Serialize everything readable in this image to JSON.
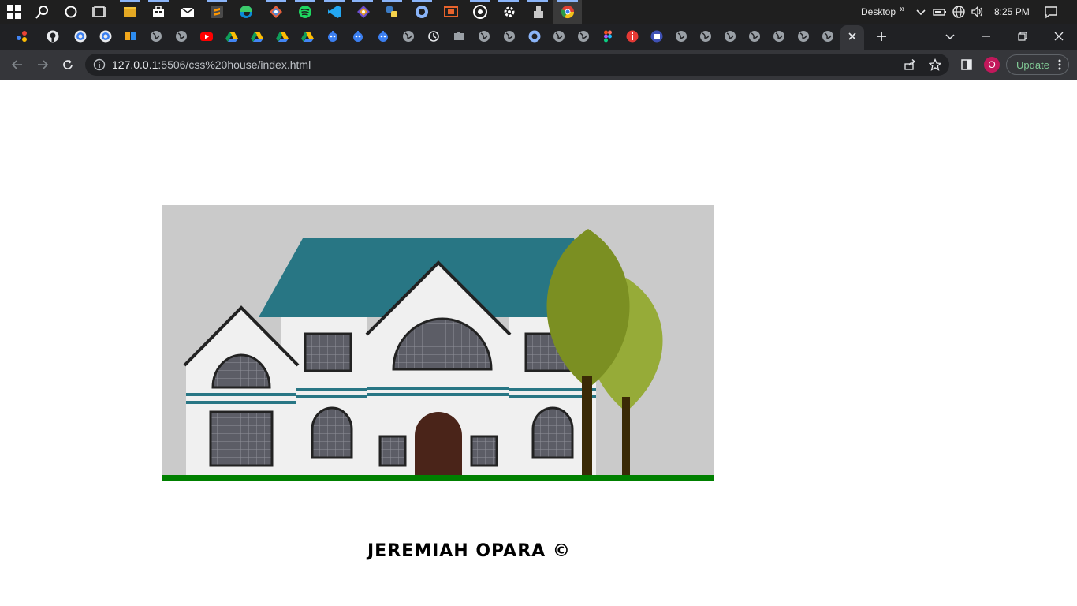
{
  "taskbar": {
    "apps": [
      "start-icon",
      "search-icon",
      "cortana-icon",
      "task-view-icon",
      "file-explorer-icon",
      "store-icon",
      "mail-icon",
      "sublime-icon",
      "edge-icon",
      "git-icon",
      "spotify-icon",
      "vscode-icon",
      "git-icon",
      "python-icon",
      "app-icon",
      "app-icon",
      "obs-icon",
      "settings-icon",
      "app-icon",
      "chrome-icon"
    ],
    "desktop_label": "Desktop",
    "overflow_glyph": "»",
    "time": "8:25 PM"
  },
  "browser": {
    "url_host": "127.0.0.1",
    "url_path": ":5506/css%20house/index.html",
    "update_label": "Update",
    "profile_initial": "O"
  },
  "scene": {
    "sky_color": "#cacaca",
    "roof_color": "#287684",
    "wall_color": "#f0f0f0",
    "window_color": "#5c5d66",
    "door_color": "#4a2419",
    "grass_color": "#008000",
    "tree_dark": "#7b8f22",
    "tree_light": "#96ab38",
    "trunk_color": "#3a2a06"
  },
  "footer": {
    "text": "JEREMIAH OPARA ©"
  }
}
